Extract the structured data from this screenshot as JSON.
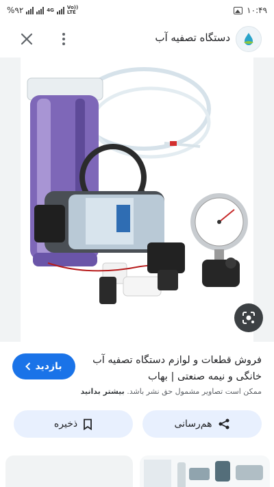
{
  "status_bar": {
    "battery": "%۹۲",
    "network_4g": "4G",
    "volte_top": "Vo))",
    "volte_bottom": "LTE",
    "time": "۱۰:۴۹"
  },
  "header": {
    "site_title": "دستگاه تصفیه آب",
    "close_icon": "close-icon",
    "more_icon": "more-vert-icon"
  },
  "caption": {
    "title": "فروش قطعات و لوازم دستگاه تصفیه آب خانگی و نیمه صنعتی | بهاب",
    "visit_label": "بازدید",
    "copyright_text": "ممکن است تصاویر مشمول حق نشر باشد.",
    "learn_more": "بیشتر بدانید"
  },
  "actions": {
    "share_label": "هم‌رسانی",
    "save_label": "ذخیره"
  },
  "colors": {
    "accent": "#1a73e8",
    "action_bg": "#e8f0fe",
    "lens_bg": "#3c4043"
  }
}
